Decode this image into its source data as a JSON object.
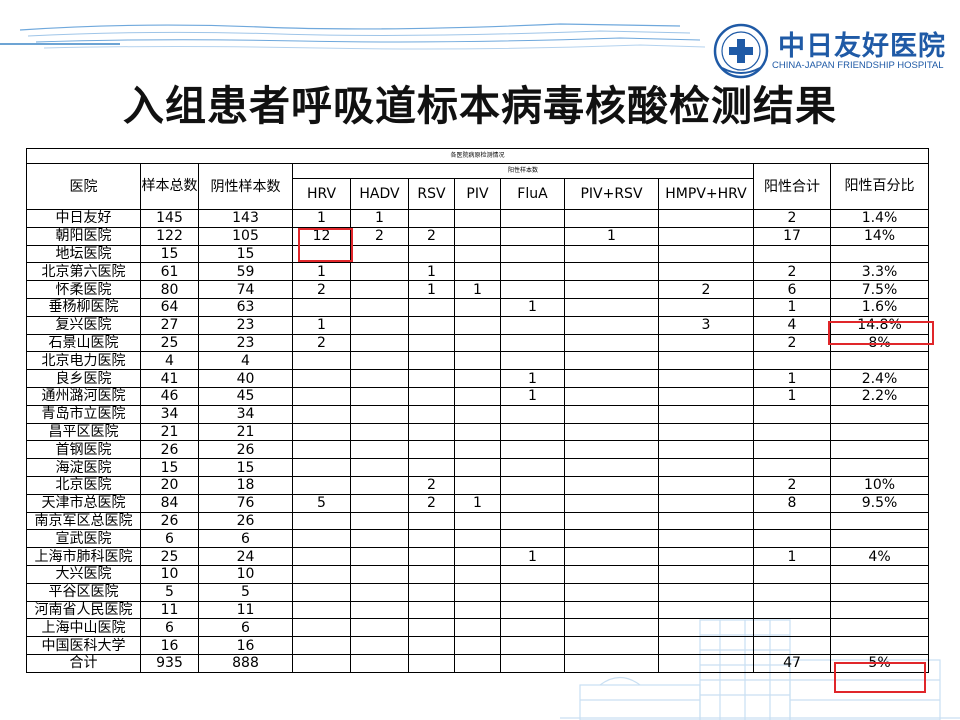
{
  "slide": {
    "title": "入组患者呼吸道标本病毒核酸检测结果",
    "brand_color": "#1f5aa6",
    "highlight_color": "#e0262a"
  },
  "logo": {
    "name_cn": "中日友好医院",
    "name_en": "CHINA-JAPAN FRIENDSHIP HOSPITAL"
  },
  "table": {
    "caption": "各医院病原检测情况",
    "positive_group_label": "阳性样本数",
    "headers": {
      "hospital": "医院",
      "total": "样本总数",
      "negative": "阴性样本数",
      "viruses": [
        "HRV",
        "HADV",
        "RSV",
        "PIV",
        "FluA",
        "PIV+RSV",
        "HMPV+HRV"
      ],
      "positive_total": "阳性合计",
      "positive_pct": "阳性百分比"
    },
    "rows": [
      {
        "hospital": "中日友好",
        "total": "145",
        "negative": "143",
        "v": [
          "1",
          "1",
          "",
          "",
          "",
          "",
          ""
        ],
        "pos": "2",
        "pct": "1.4%"
      },
      {
        "hospital": "朝阳医院",
        "total": "122",
        "negative": "105",
        "v": [
          "12",
          "2",
          "2",
          "",
          "",
          "1",
          ""
        ],
        "pos": "17",
        "pct": "14%"
      },
      {
        "hospital": "地坛医院",
        "total": "15",
        "negative": "15",
        "v": [
          "",
          "",
          "",
          "",
          "",
          "",
          ""
        ],
        "pos": "",
        "pct": ""
      },
      {
        "hospital": "北京第六医院",
        "total": "61",
        "negative": "59",
        "v": [
          "1",
          "",
          "1",
          "",
          "",
          "",
          ""
        ],
        "pos": "2",
        "pct": "3.3%"
      },
      {
        "hospital": "怀柔医院",
        "total": "80",
        "negative": "74",
        "v": [
          "2",
          "",
          "1",
          "1",
          "",
          "",
          "2"
        ],
        "pos": "6",
        "pct": "7.5%"
      },
      {
        "hospital": "垂杨柳医院",
        "total": "64",
        "negative": "63",
        "v": [
          "",
          "",
          "",
          "",
          "1",
          "",
          ""
        ],
        "pos": "1",
        "pct": "1.6%"
      },
      {
        "hospital": "复兴医院",
        "total": "27",
        "negative": "23",
        "v": [
          "1",
          "",
          "",
          "",
          "",
          "",
          "3"
        ],
        "pos": "4",
        "pct": "14.8%"
      },
      {
        "hospital": "石景山医院",
        "total": "25",
        "negative": "23",
        "v": [
          "2",
          "",
          "",
          "",
          "",
          "",
          ""
        ],
        "pos": "2",
        "pct": "8%"
      },
      {
        "hospital": "北京电力医院",
        "total": "4",
        "negative": "4",
        "v": [
          "",
          "",
          "",
          "",
          "",
          "",
          ""
        ],
        "pos": "",
        "pct": ""
      },
      {
        "hospital": "良乡医院",
        "total": "41",
        "negative": "40",
        "v": [
          "",
          "",
          "",
          "",
          "1",
          "",
          ""
        ],
        "pos": "1",
        "pct": "2.4%"
      },
      {
        "hospital": "通州潞河医院",
        "total": "46",
        "negative": "45",
        "v": [
          "",
          "",
          "",
          "",
          "1",
          "",
          ""
        ],
        "pos": "1",
        "pct": "2.2%"
      },
      {
        "hospital": "青岛市立医院",
        "total": "34",
        "negative": "34",
        "v": [
          "",
          "",
          "",
          "",
          "",
          "",
          ""
        ],
        "pos": "",
        "pct": ""
      },
      {
        "hospital": "昌平区医院",
        "total": "21",
        "negative": "21",
        "v": [
          "",
          "",
          "",
          "",
          "",
          "",
          ""
        ],
        "pos": "",
        "pct": ""
      },
      {
        "hospital": "首钢医院",
        "total": "26",
        "negative": "26",
        "v": [
          "",
          "",
          "",
          "",
          "",
          "",
          ""
        ],
        "pos": "",
        "pct": ""
      },
      {
        "hospital": "海淀医院",
        "total": "15",
        "negative": "15",
        "v": [
          "",
          "",
          "",
          "",
          "",
          "",
          ""
        ],
        "pos": "",
        "pct": ""
      },
      {
        "hospital": "北京医院",
        "total": "20",
        "negative": "18",
        "v": [
          "",
          "",
          "2",
          "",
          "",
          "",
          ""
        ],
        "pos": "2",
        "pct": "10%"
      },
      {
        "hospital": "天津市总医院",
        "total": "84",
        "negative": "76",
        "v": [
          "5",
          "",
          "2",
          "1",
          "",
          "",
          ""
        ],
        "pos": "8",
        "pct": "9.5%"
      },
      {
        "hospital": "南京军区总医院",
        "total": "26",
        "negative": "26",
        "v": [
          "",
          "",
          "",
          "",
          "",
          "",
          ""
        ],
        "pos": "",
        "pct": ""
      },
      {
        "hospital": "宣武医院",
        "total": "6",
        "negative": "6",
        "v": [
          "",
          "",
          "",
          "",
          "",
          "",
          ""
        ],
        "pos": "",
        "pct": ""
      },
      {
        "hospital": "上海市肺科医院",
        "total": "25",
        "negative": "24",
        "v": [
          "",
          "",
          "",
          "",
          "1",
          "",
          ""
        ],
        "pos": "1",
        "pct": "4%"
      },
      {
        "hospital": "大兴医院",
        "total": "10",
        "negative": "10",
        "v": [
          "",
          "",
          "",
          "",
          "",
          "",
          ""
        ],
        "pos": "",
        "pct": ""
      },
      {
        "hospital": "平谷区医院",
        "total": "5",
        "negative": "5",
        "v": [
          "",
          "",
          "",
          "",
          "",
          "",
          ""
        ],
        "pos": "",
        "pct": ""
      },
      {
        "hospital": "河南省人民医院",
        "total": "11",
        "negative": "11",
        "v": [
          "",
          "",
          "",
          "",
          "",
          "",
          ""
        ],
        "pos": "",
        "pct": ""
      },
      {
        "hospital": "上海中山医院",
        "total": "6",
        "negative": "6",
        "v": [
          "",
          "",
          "",
          "",
          "",
          "",
          ""
        ],
        "pos": "",
        "pct": ""
      },
      {
        "hospital": "中国医科大学",
        "total": "16",
        "negative": "16",
        "v": [
          "",
          "",
          "",
          "",
          "",
          "",
          ""
        ],
        "pos": "",
        "pct": ""
      },
      {
        "hospital": "合计",
        "total": "935",
        "negative": "888",
        "v": [
          "",
          "",
          "",
          "",
          "",
          "",
          ""
        ],
        "pos": "47",
        "pct": "5%"
      }
    ]
  }
}
